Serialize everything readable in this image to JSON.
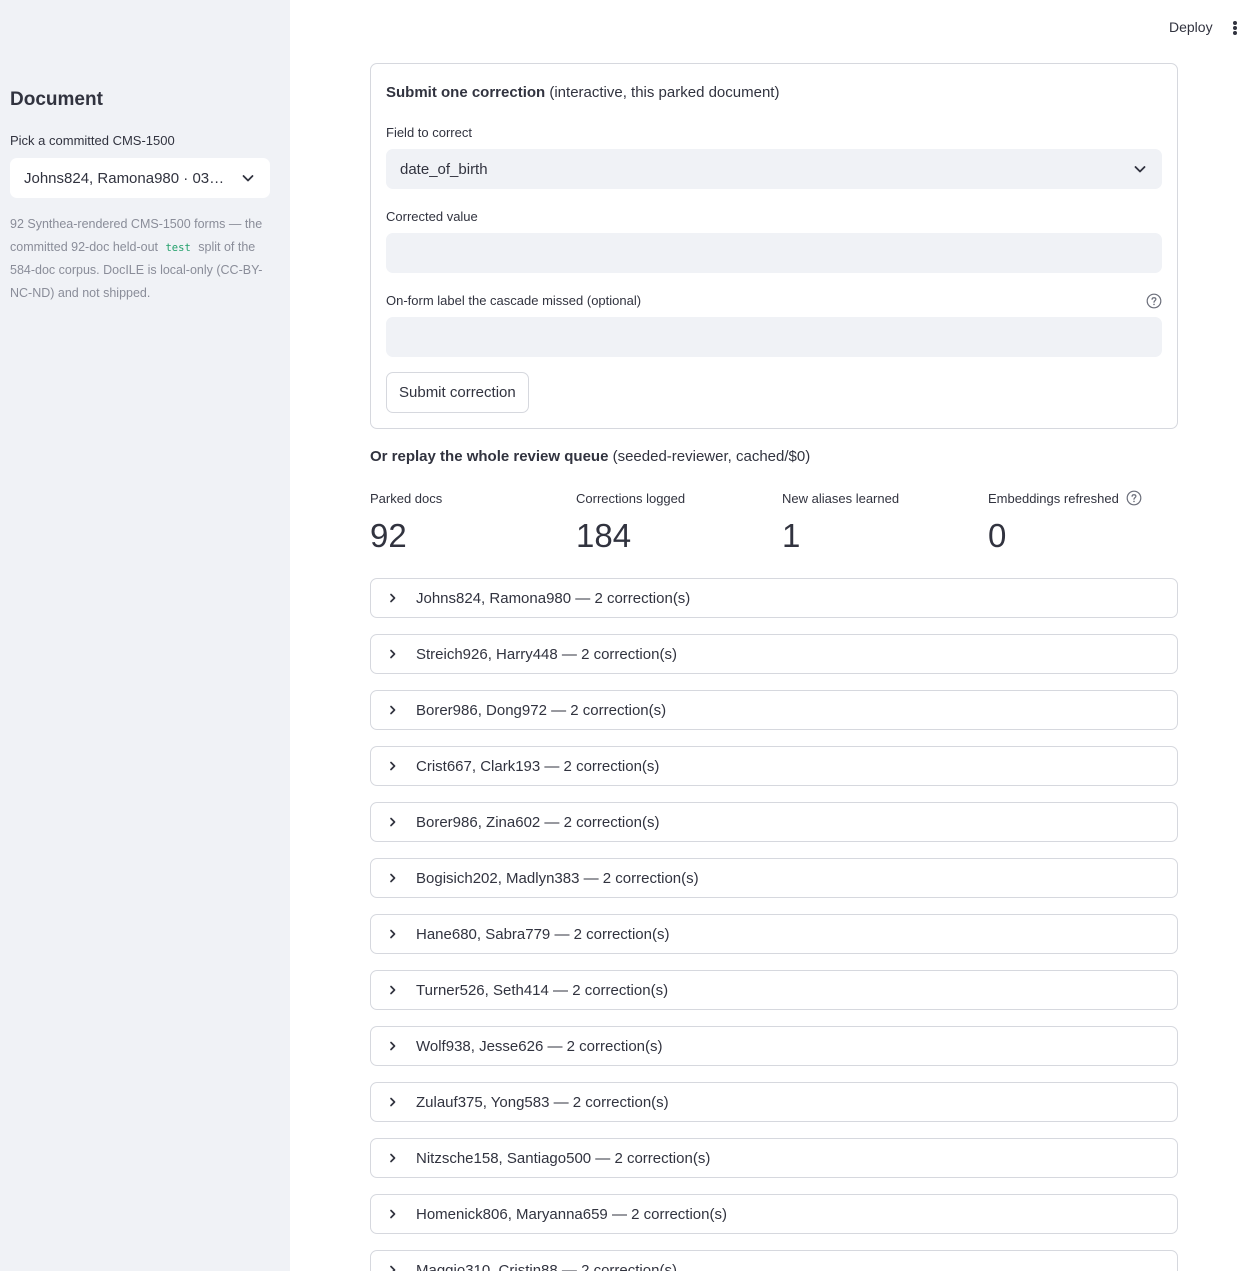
{
  "sidebar": {
    "title": "Document",
    "select_label": "Pick a committed CMS-1500",
    "select_value": "Johns824, Ramona980 · 032…",
    "caption_before": "92 Synthea-rendered CMS-1500 forms — the committed 92-doc held-out",
    "caption_code": "test",
    "caption_after": "split of the 584-doc corpus. DocILE is local-only (CC-BY-NC-ND) and not shipped."
  },
  "header": {
    "deploy_label": "Deploy"
  },
  "form": {
    "title_bold": "Submit one correction",
    "title_rest": " (interactive, this parked document)",
    "field_label": "Field to correct",
    "field_value": "date_of_birth",
    "corrected_label": "Corrected value",
    "corrected_value": "",
    "missed_label": "On-form label the cascade missed (optional)",
    "missed_value": "",
    "submit_label": "Submit correction"
  },
  "replay": {
    "title_bold": "Or replay the whole review queue",
    "title_rest": " (seeded-reviewer, cached/$0)"
  },
  "metrics": [
    {
      "label": "Parked docs",
      "value": "92"
    },
    {
      "label": "Corrections logged",
      "value": "184"
    },
    {
      "label": "New aliases learned",
      "value": "1"
    },
    {
      "label": "Embeddings refreshed",
      "value": "0"
    }
  ],
  "expanders": [
    "Johns824, Ramona980 — 2 correction(s)",
    "Streich926, Harry448 — 2 correction(s)",
    "Borer986, Dong972 — 2 correction(s)",
    "Crist667, Clark193 — 2 correction(s)",
    "Borer986, Zina602 — 2 correction(s)",
    "Bogisich202, Madlyn383 — 2 correction(s)",
    "Hane680, Sabra779 — 2 correction(s)",
    "Turner526, Seth414 — 2 correction(s)",
    "Wolf938, Jesse626 — 2 correction(s)",
    "Zulauf375, Yong583 — 2 correction(s)",
    "Nitzsche158, Santiago500 — 2 correction(s)",
    "Homenick806, Maryanna659 — 2 correction(s)",
    "Maggio310, Cristin88 — 2 correction(s)"
  ]
}
